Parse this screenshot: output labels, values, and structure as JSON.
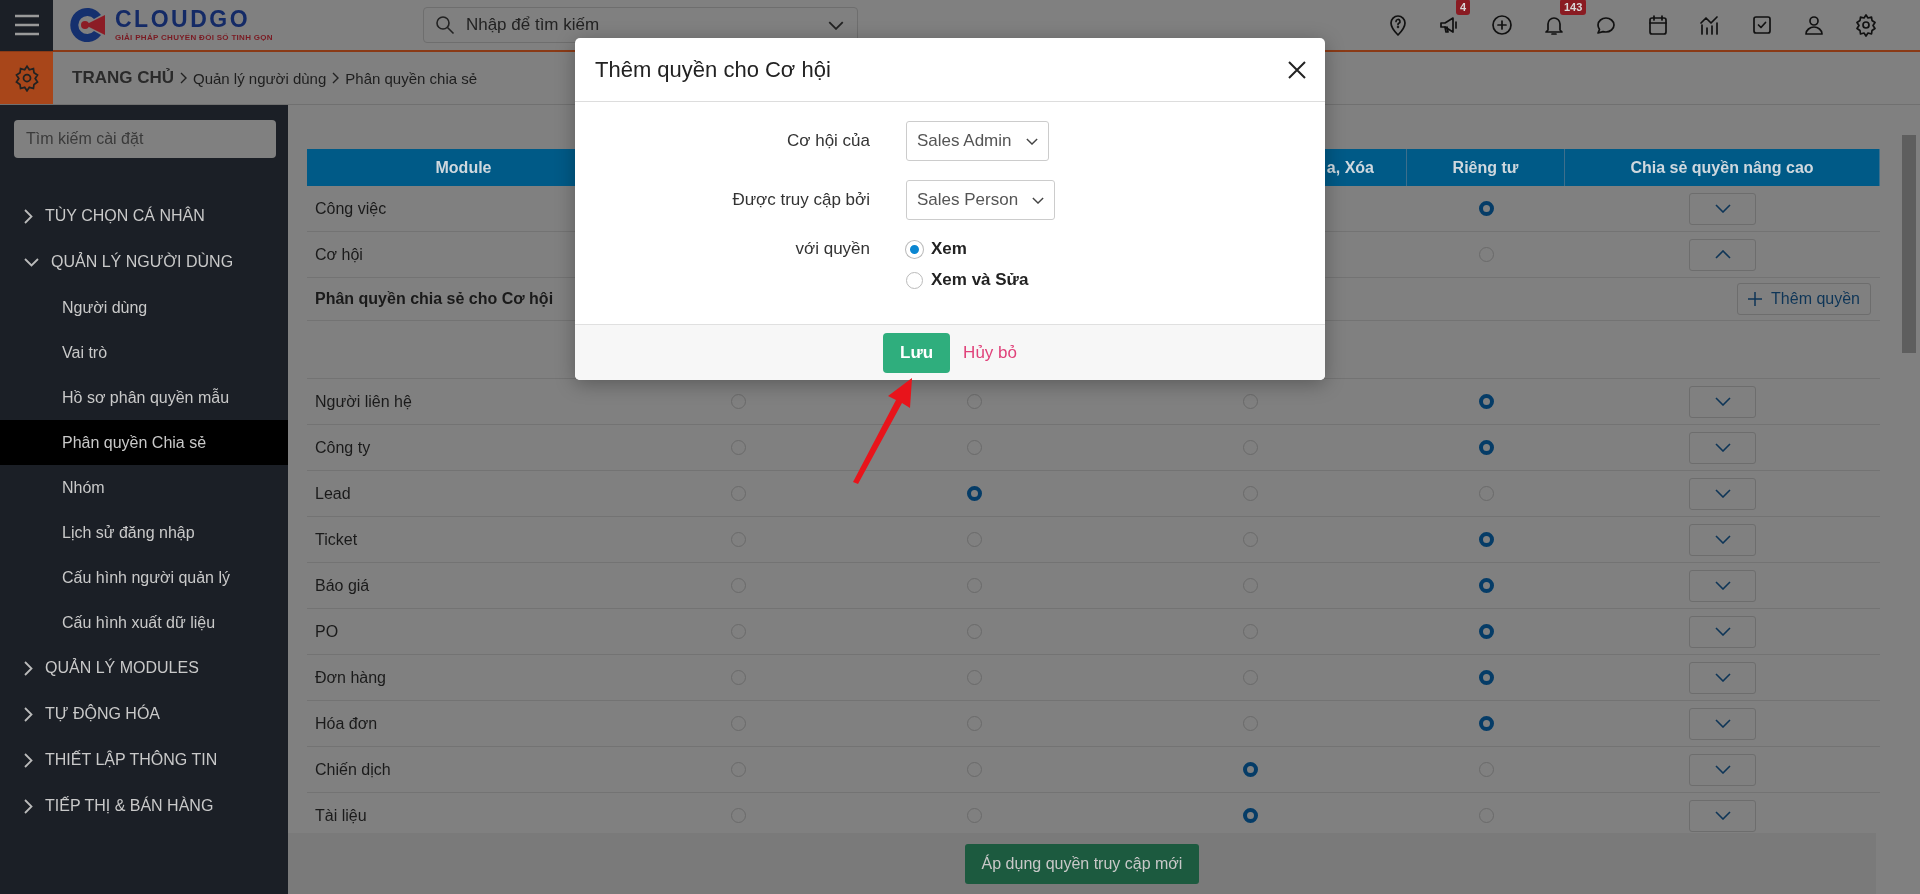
{
  "topbar": {
    "logo": {
      "name": "CLOUDGO",
      "tagline": "GIẢI PHÁP CHUYỂN ĐỔI SỐ TINH GỌN"
    },
    "search": {
      "placeholder": "Nhập để tìm kiếm"
    },
    "icons": [
      {
        "kind": "help-pin"
      },
      {
        "kind": "megaphone",
        "badge": "4"
      },
      {
        "kind": "plus"
      },
      {
        "kind": "bell",
        "badge": "143"
      },
      {
        "kind": "chat"
      },
      {
        "kind": "calendar"
      },
      {
        "kind": "chart"
      },
      {
        "kind": "task"
      },
      {
        "kind": "user"
      },
      {
        "kind": "settings"
      }
    ]
  },
  "breadcrumb": [
    "TRANG CHỦ",
    "Quản lý người dùng",
    "Phân quyền chia sẻ"
  ],
  "sidebar": {
    "search": {
      "placeholder": "Tìm kiếm cài đặt"
    },
    "sections": [
      {
        "label": "TÙY CHỌN CÁ NHÂN",
        "expanded": false
      },
      {
        "label": "QUẢN LÝ NGƯỜI DÙNG",
        "expanded": true,
        "children": [
          {
            "label": "Người dùng",
            "selected": false
          },
          {
            "label": "Vai trò",
            "selected": false
          },
          {
            "label": "Hồ sơ phân quyền mẫu",
            "selected": false
          },
          {
            "label": "Phân quyền Chia sẻ",
            "selected": true
          },
          {
            "label": "Nhóm",
            "selected": false
          },
          {
            "label": "Lịch sử đăng nhập",
            "selected": false
          },
          {
            "label": "Cấu hình người quản lý",
            "selected": false
          },
          {
            "label": "Cấu hình xuất dữ liệu",
            "selected": false
          }
        ]
      },
      {
        "label": "QUẢN LÝ MODULES",
        "expanded": false
      },
      {
        "label": "TỰ ĐỘNG HÓA",
        "expanded": false
      },
      {
        "label": "THIẾT LẬP THÔNG TIN",
        "expanded": false
      },
      {
        "label": "TIẾP THỊ & BÁN HÀNG",
        "expanded": false
      }
    ]
  },
  "table": {
    "columns": [
      "Module",
      "a, Xóa",
      "Riêng tư",
      "Chia sẻ quyền nâng cao"
    ],
    "rows": [
      {
        "kind": "module",
        "module": "Công việc",
        "radios": [
          {
            "selected": true
          }
        ],
        "expanded": false
      },
      {
        "kind": "module",
        "module": "Cơ hội",
        "radios": [
          {
            "selected": false
          }
        ],
        "expanded": true
      },
      {
        "kind": "section",
        "title": "Phân quyền chia sẻ cho Cơ hội",
        "button": "Thêm quyền"
      },
      {
        "kind": "blank"
      },
      {
        "kind": "module",
        "module": "Người liên hệ",
        "radios": [
          {
            "selected": false
          },
          {
            "selected": false
          },
          {
            "selected": false
          },
          {
            "selected": true
          }
        ],
        "expanded": false
      },
      {
        "kind": "module",
        "module": "Công ty",
        "radios": [
          {
            "selected": false
          },
          {
            "selected": false
          },
          {
            "selected": false
          },
          {
            "selected": true
          }
        ],
        "expanded": false
      },
      {
        "kind": "module",
        "module": "Lead",
        "radios": [
          {
            "selected": false
          },
          {
            "selected": true
          },
          {
            "selected": false
          },
          {
            "selected": false
          }
        ],
        "expanded": false
      },
      {
        "kind": "module",
        "module": "Ticket",
        "radios": [
          {
            "selected": false
          },
          {
            "selected": false
          },
          {
            "selected": false
          },
          {
            "selected": true
          }
        ],
        "expanded": false
      },
      {
        "kind": "module",
        "module": "Báo giá",
        "radios": [
          {
            "selected": false
          },
          {
            "selected": false
          },
          {
            "selected": false
          },
          {
            "selected": true
          }
        ],
        "expanded": false
      },
      {
        "kind": "module",
        "module": "PO",
        "radios": [
          {
            "selected": false
          },
          {
            "selected": false
          },
          {
            "selected": false
          },
          {
            "selected": true
          }
        ],
        "expanded": false
      },
      {
        "kind": "module",
        "module": "Đơn hàng",
        "radios": [
          {
            "selected": false
          },
          {
            "selected": false
          },
          {
            "selected": false
          },
          {
            "selected": true
          }
        ],
        "expanded": false
      },
      {
        "kind": "module",
        "module": "Hóa đơn",
        "radios": [
          {
            "selected": false
          },
          {
            "selected": false
          },
          {
            "selected": false
          },
          {
            "selected": true
          }
        ],
        "expanded": false
      },
      {
        "kind": "module",
        "module": "Chiến dịch",
        "radios": [
          {
            "selected": false
          },
          {
            "selected": false
          },
          {
            "selected": true
          },
          {
            "selected": false
          }
        ],
        "expanded": false
      },
      {
        "kind": "module",
        "module": "Tài liệu",
        "radios": [
          {
            "selected": false
          },
          {
            "selected": false
          },
          {
            "selected": true
          },
          {
            "selected": false
          }
        ],
        "expanded": false
      }
    ]
  },
  "footer": {
    "apply_button": "Áp dụng quyền truy cập mới"
  },
  "dialog": {
    "title": "Thêm quyền cho Cơ hội",
    "fields": [
      {
        "label": "Cơ hội của",
        "value": "Sales Admin"
      },
      {
        "label": "Được truy cập bởi",
        "value": "Sales Person"
      }
    ],
    "permission": {
      "label": "với quyền",
      "options": [
        {
          "label": "Xem",
          "selected": true
        },
        {
          "label": "Xem và Sửa",
          "selected": false
        }
      ]
    },
    "save_button": "Lưu",
    "cancel_link": "Hủy bỏ"
  }
}
